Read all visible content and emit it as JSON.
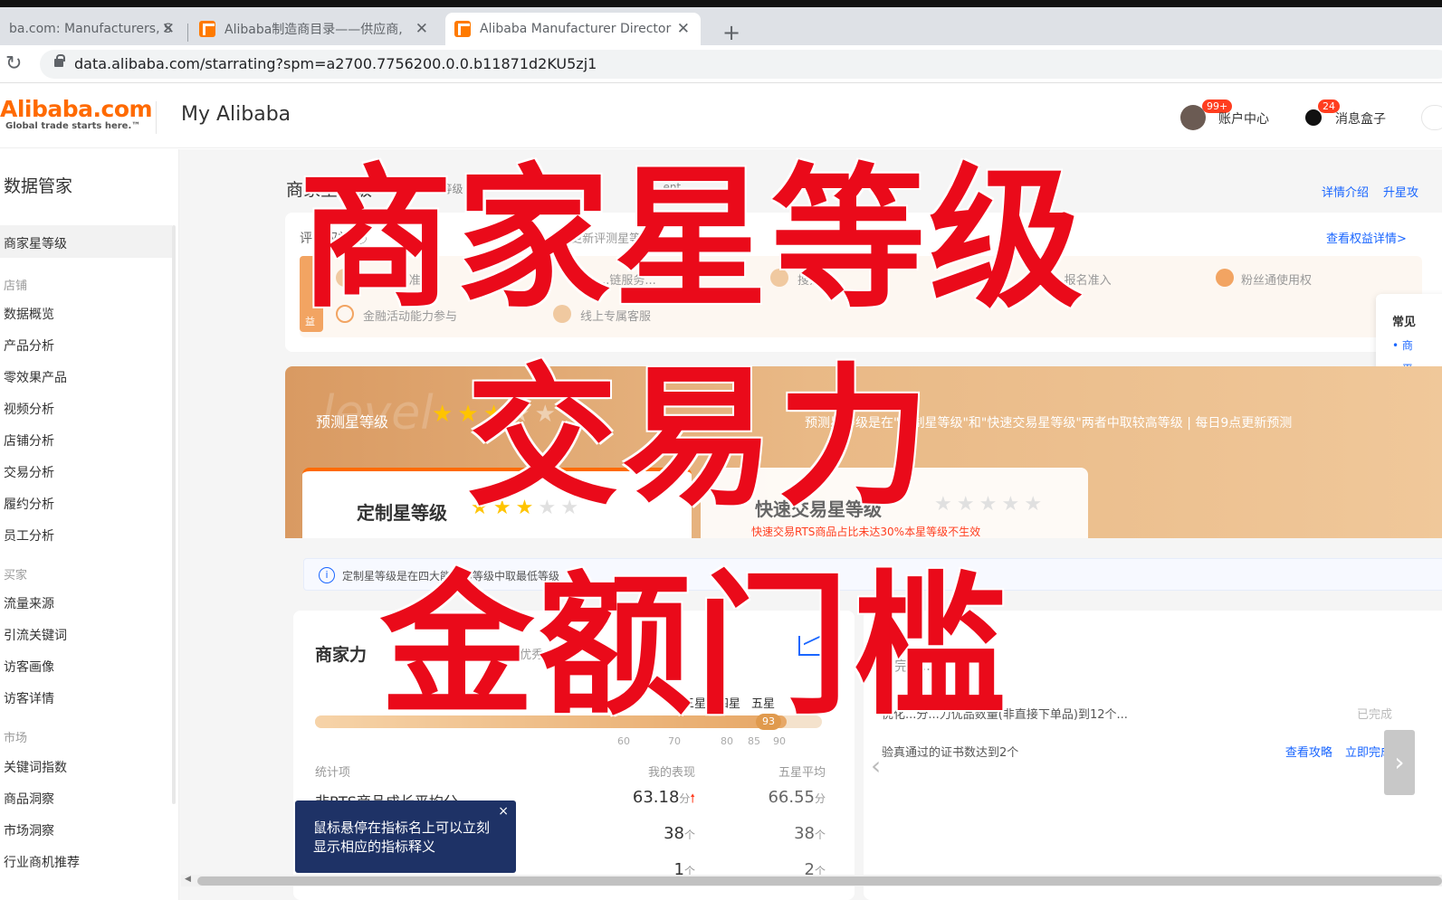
{
  "browser": {
    "tabs": [
      {
        "title": "ba.com: Manufacturers, S"
      },
      {
        "title": "Alibaba制造商目录——供应商,"
      },
      {
        "title": "Alibaba Manufacturer Director"
      }
    ],
    "new_tab": "+",
    "url": "data.alibaba.com/starrating?spm=a2700.7756200.0.0.b11871d2KU5zj1"
  },
  "header": {
    "logo": "Alibaba.com",
    "logo_tagline": "Global trade starts here.™",
    "title": "My Alibaba",
    "account_badge": "99+",
    "account_label": "账户中心",
    "message_badge": "24",
    "message_label": "消息盒子"
  },
  "sidebar": {
    "title": "数据管家",
    "active_item": "商家星等级",
    "sections": [
      {
        "label": "店铺",
        "items": [
          "数据概览",
          "产品分析",
          "零效果产品",
          "视频分析",
          "店铺分析",
          "交易分析",
          "履约分析",
          "员工分析"
        ]
      },
      {
        "label": "买家",
        "items": [
          "流量来源",
          "引流关键词",
          "访客画像",
          "访客详情"
        ]
      },
      {
        "label": "市场",
        "items": [
          "关键词指数",
          "商品洞察",
          "市场洞察",
          "行业商机推荐"
        ]
      }
    ]
  },
  "main": {
    "page_title": "商家星等级",
    "breadcrumb_sub": "...等级",
    "breadcrumb_sub2": "...ent",
    "top_links": [
      "详情介绍",
      "升星攻"
    ],
    "rights": {
      "label": "评星权益 ⓘ",
      "note": "(更新评测星等级)",
      "link": "查看权益详情>",
      "tag": "益",
      "items": [
        "...活动...准入",
        "...链服务...",
        "搜索...",
        "...y Da...报名准入",
        "粉丝通使用权",
        "金融活动能力参与",
        "线上专属客服"
      ]
    },
    "help": {
      "title": "常见",
      "items": [
        "商",
        "平"
      ]
    },
    "predict": {
      "ghost": "level",
      "label": "预测星等级",
      "note": "预测星等级是在\"定制星等级\"和\"快速交易星等级\"两者中取较高等级 | 每日9点更新预测"
    },
    "level_tabs": {
      "custom": "定制星等级",
      "fast": "快速交易星等级",
      "fast_warning": "快速交易RTS商品占比未达30%本星等级不生效"
    },
    "info_text": "定制星等级是在四大能力项等级中取最低等级",
    "power": {
      "title": "商家力",
      "tab_active": "三星",
      "tab_industry": "行业优秀",
      "scale_labels": [
        "三星",
        "四星",
        "五星"
      ],
      "score": "93",
      "ticks": [
        "60",
        "70",
        "80",
        "85",
        "90"
      ],
      "col_stat": "统计项",
      "col_mine": "我的表现",
      "col_avg": "五星平均",
      "rows": [
        {
          "name": "非RTS商品成长平均分",
          "mine": "63.18",
          "mine_unit": "分",
          "avg": "66.55",
          "avg_unit": "分",
          "up": "🠕"
        },
        {
          "name": "",
          "mine": "38",
          "mine_unit": "个",
          "avg": "38",
          "avg_unit": "个",
          "up": ""
        },
        {
          "name": "",
          "mine": "1",
          "mine_unit": "个",
          "avg": "2",
          "avg_unit": "个",
          "up": ""
        }
      ]
    },
    "tooltip": {
      "text": "鼠标悬停在指标名上可以立刻显示相应的指标释义",
      "close": "×"
    },
    "tasks": {
      "title": "...完成...",
      "row1": "优化...分...力优品数量(非直接下单品)到12个...",
      "row1_status": "已完成",
      "row2": "验真通过的证书数达到2个",
      "row2_link1": "查看攻略",
      "row2_link2": "立即完成"
    }
  },
  "overlay": {
    "line1": "商家星等级",
    "line2": "交易力",
    "line3": "金额门槛"
  },
  "progress": {
    "score_fraction": 0.93
  },
  "colors": {
    "brand": "#ff6a00",
    "overlay_red": "#ea0a1a",
    "link_blue": "#1a66ff"
  }
}
